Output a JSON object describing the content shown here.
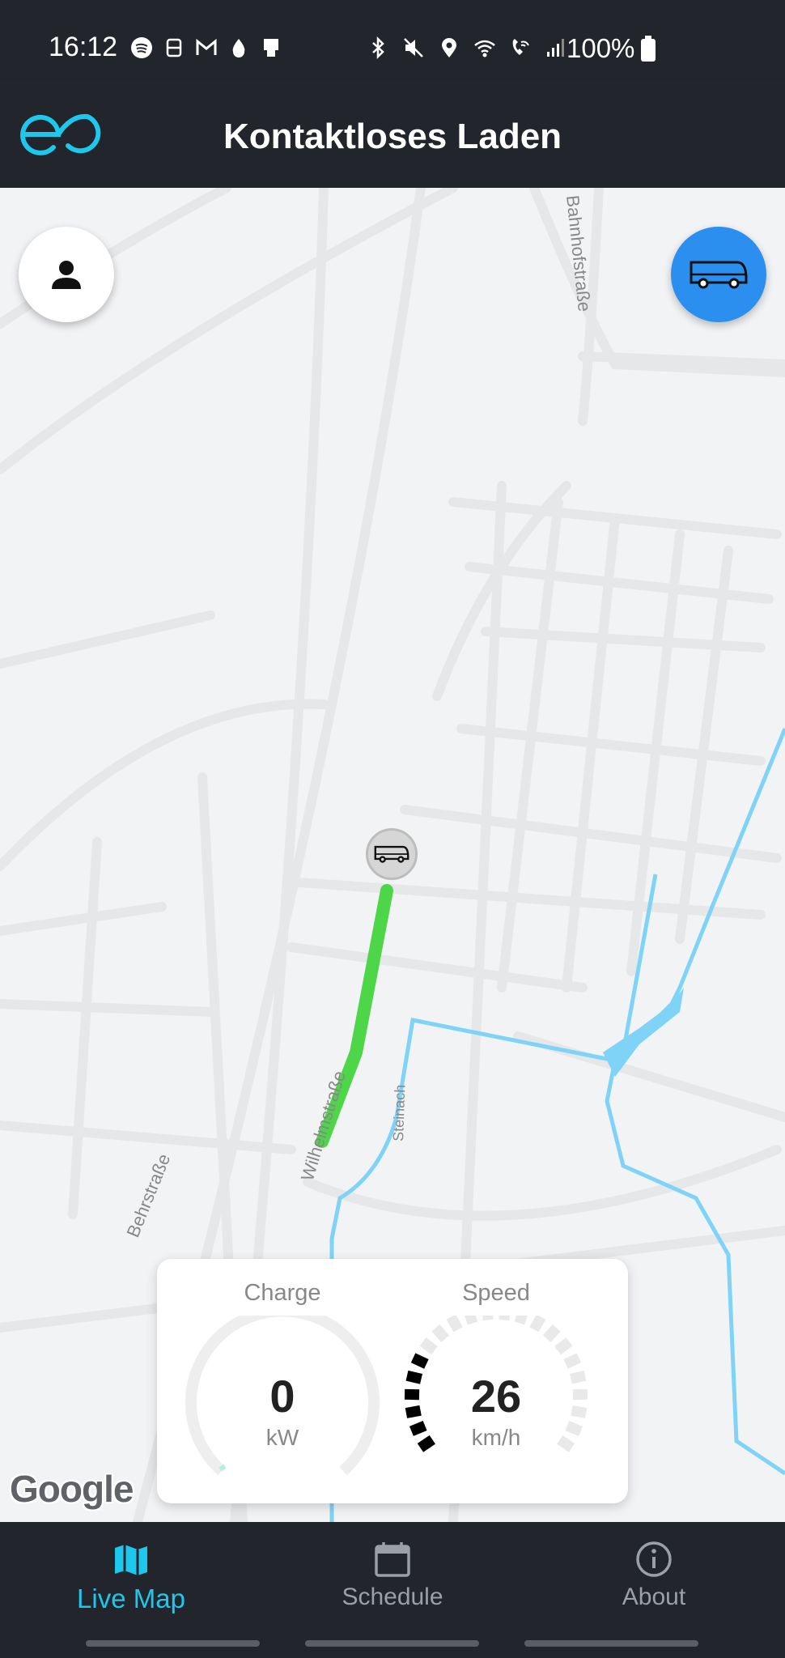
{
  "status_bar": {
    "time": "16:12",
    "battery": "100%",
    "left_icons": [
      "spotify-icon",
      "notification-icon",
      "gmail-icon",
      "drop-icon",
      "cast-icon"
    ],
    "right_icons": [
      "bluetooth-icon",
      "mute-icon",
      "location-icon",
      "wifi-icon",
      "wifi-calling-icon",
      "signal-icon",
      "battery-icon"
    ]
  },
  "app_bar": {
    "title": "Kontaktloses Laden",
    "logo": "eo-logo"
  },
  "map": {
    "street_labels": [
      "Bahnhofstraße",
      "Wilhelmstraße",
      "Steinach",
      "Behrstraße"
    ],
    "route_color": "#4cd648",
    "water_color": "#7fd3f7",
    "attribution": "Google"
  },
  "buttons": {
    "user": "user-icon",
    "bus": "bus-icon"
  },
  "dashboard": {
    "charge": {
      "label": "Charge",
      "value": "0",
      "unit": "kW",
      "level": 0
    },
    "speed": {
      "label": "Speed",
      "value": "26",
      "unit": "km/h",
      "active_segments": 6,
      "total_segments": 22
    }
  },
  "bottom_nav": {
    "items": [
      {
        "label": "Live Map",
        "icon": "map-icon",
        "active": true
      },
      {
        "label": "Schedule",
        "icon": "calendar-icon",
        "active": false
      },
      {
        "label": "About",
        "icon": "info-icon",
        "active": false
      }
    ]
  },
  "colors": {
    "bar_bg": "#22252b",
    "accent": "#1ec8ec",
    "fab_blue": "#2b8ff0"
  }
}
